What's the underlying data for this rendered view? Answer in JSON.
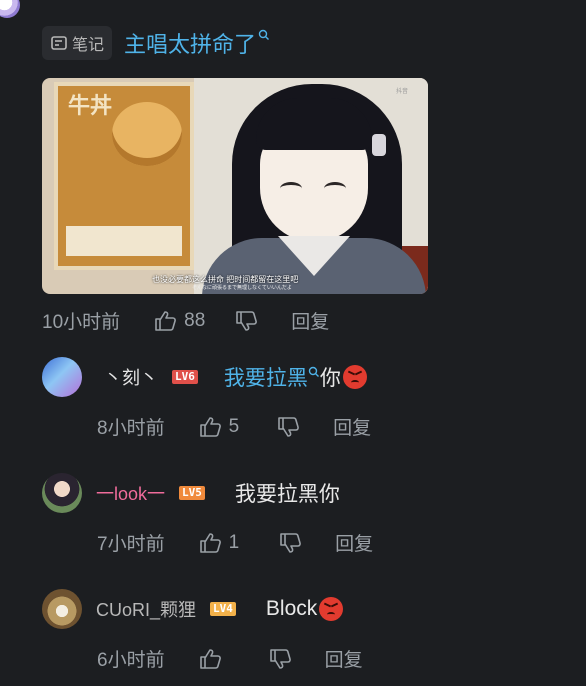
{
  "note": {
    "tag_label": "笔记",
    "title": "主唱太拼命了"
  },
  "video": {
    "subtitle_cn": "也没必要都这么拼命 把时间都留在这里吧",
    "subtitle_jp": "そんなに頑張るまで無理しなくていいんだよ",
    "corner_mark": "抖音",
    "poster_text": "牛丼"
  },
  "main_meta": {
    "time": "10小时前",
    "likes": "88",
    "reply_label": "回复"
  },
  "comments": [
    {
      "username": "丶刻丶",
      "username_color": "#e6e6e6",
      "level": "LV6",
      "level_color": "#e0504a",
      "text_link": "我要拉黑",
      "text_rest": "你",
      "emoji": "angry-face",
      "time": "8小时前",
      "likes": "5",
      "reply_label": "回复"
    },
    {
      "username": "一look一",
      "username_color": "#f06c9b",
      "level": "LV5",
      "level_color": "#f08a3c",
      "text": "我要拉黑你",
      "time": "7小时前",
      "likes": "1",
      "reply_label": "回复"
    },
    {
      "username": "CUoRI_颗狸",
      "username_color": "#b8b8b8",
      "level": "LV4",
      "level_color": "#f2b14a",
      "text": "Block",
      "emoji": "angry-face",
      "time": "6小时前",
      "likes": "",
      "reply_label": "回复"
    }
  ],
  "colors": {
    "background": "#1c1e21",
    "link": "#4fb3e8",
    "meta": "#9aa0a6"
  }
}
